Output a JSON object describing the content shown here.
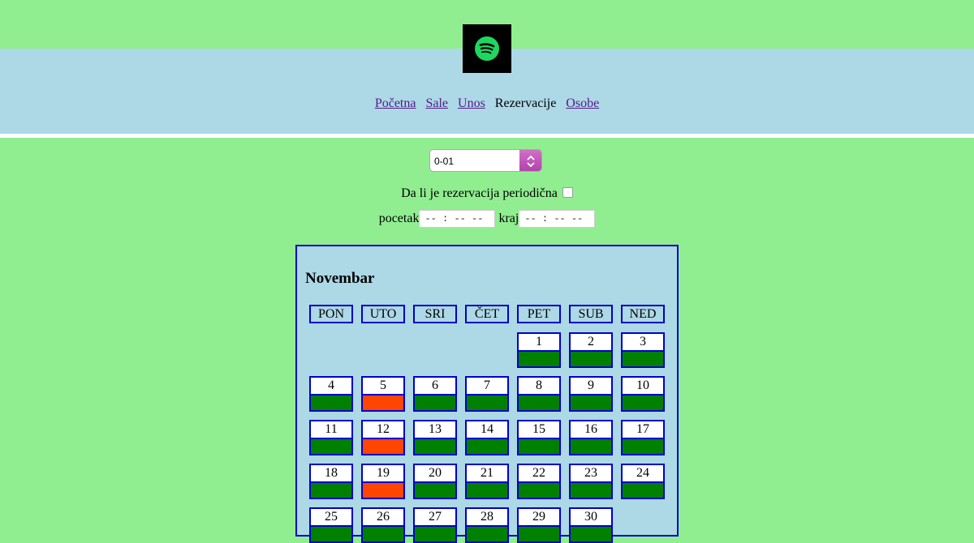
{
  "logo": {
    "icon": "spotify-logo-icon",
    "bg": "#000000",
    "color": "#1ed760"
  },
  "nav": {
    "items": [
      {
        "label": "Početna",
        "link": true
      },
      {
        "label": "Sale",
        "link": true
      },
      {
        "label": "Unos",
        "link": true
      },
      {
        "label": "Rezervacije",
        "link": false
      },
      {
        "label": "Osobe",
        "link": true
      }
    ]
  },
  "form": {
    "hall_value": "0-01",
    "periodic_label": "Da li je rezervacija periodična",
    "start_label": "pocetak",
    "end_label": "kraj",
    "time_placeholder": "-- : --   --"
  },
  "calendar": {
    "month": "Novembar",
    "weekdays": [
      "PON",
      "UTO",
      "SRI",
      "ČET",
      "PET",
      "SUB",
      "NED"
    ],
    "first_weekday_index": 4,
    "colors": {
      "free": "#008000",
      "busy": "#ff4500"
    },
    "days": [
      {
        "n": "1",
        "s": "free"
      },
      {
        "n": "2",
        "s": "free"
      },
      {
        "n": "3",
        "s": "free"
      },
      {
        "n": "4",
        "s": "free"
      },
      {
        "n": "5",
        "s": "busy"
      },
      {
        "n": "6",
        "s": "free"
      },
      {
        "n": "7",
        "s": "free"
      },
      {
        "n": "8",
        "s": "free"
      },
      {
        "n": "9",
        "s": "free"
      },
      {
        "n": "10",
        "s": "free"
      },
      {
        "n": "11",
        "s": "free"
      },
      {
        "n": "12",
        "s": "busy"
      },
      {
        "n": "13",
        "s": "free"
      },
      {
        "n": "14",
        "s": "free"
      },
      {
        "n": "15",
        "s": "free"
      },
      {
        "n": "16",
        "s": "free"
      },
      {
        "n": "17",
        "s": "free"
      },
      {
        "n": "18",
        "s": "free"
      },
      {
        "n": "19",
        "s": "busy"
      },
      {
        "n": "20",
        "s": "free"
      },
      {
        "n": "21",
        "s": "free"
      },
      {
        "n": "22",
        "s": "free"
      },
      {
        "n": "23",
        "s": "free"
      },
      {
        "n": "24",
        "s": "free"
      },
      {
        "n": "25",
        "s": "free"
      },
      {
        "n": "26",
        "s": "free"
      },
      {
        "n": "27",
        "s": "free"
      },
      {
        "n": "28",
        "s": "free"
      },
      {
        "n": "29",
        "s": "free"
      },
      {
        "n": "30",
        "s": "free"
      }
    ]
  }
}
